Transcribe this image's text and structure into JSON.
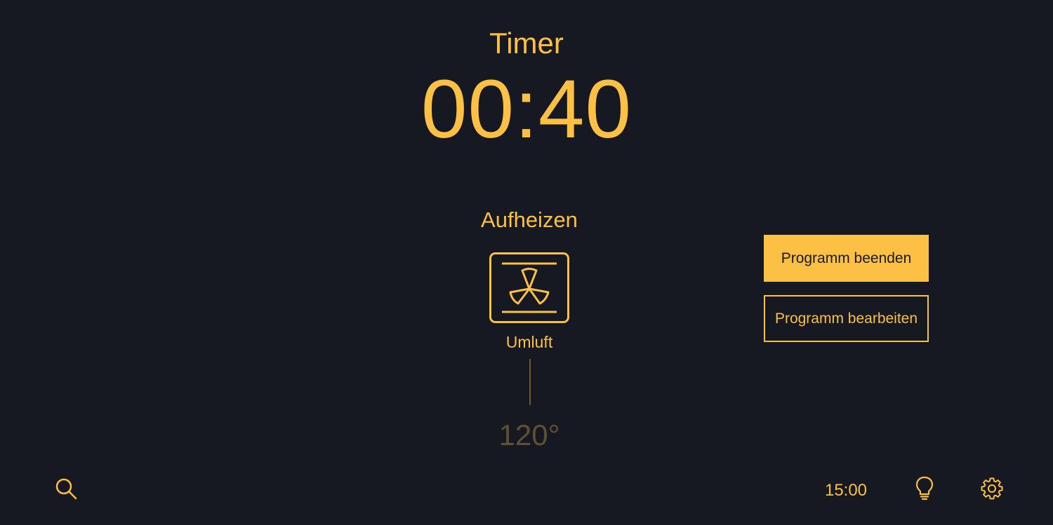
{
  "timer": {
    "title": "Timer",
    "value": "00:40"
  },
  "status": {
    "text": "Aufheizen"
  },
  "mode": {
    "icon": "convection-fan-oven-icon",
    "label": "Umluft"
  },
  "temperature": {
    "value": "120°"
  },
  "actions": {
    "end_program_label": "Programm beenden",
    "edit_program_label": "Programm bearbeiten"
  },
  "footer": {
    "clock": "15:00",
    "icons": [
      "search-icon",
      "lightbulb-icon",
      "gear-icon"
    ]
  },
  "colors": {
    "background": "#161822",
    "accent": "#fcc044",
    "muted_text": "#5f5032",
    "button_text": "#1a1a1f"
  }
}
